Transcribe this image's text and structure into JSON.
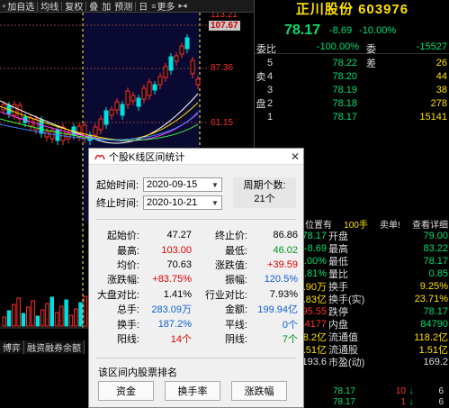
{
  "toolbar": {
    "items": [
      {
        "label": "加自选"
      },
      {
        "label": "均线"
      },
      {
        "label": "复权"
      },
      {
        "label": "叠"
      },
      {
        "label": "加"
      },
      {
        "label": "预测"
      },
      {
        "label": "日"
      },
      {
        "label": "更多"
      }
    ]
  },
  "chart": {
    "price_top": "113.21",
    "price_box": "107.67",
    "price_mid": "87.36",
    "price_low": "61.15",
    "bottom_tabs": [
      "博弈",
      "融资融券余额"
    ]
  },
  "quote": {
    "name": "正川股份",
    "code": "603976",
    "price": "78.17",
    "change": "-8.69",
    "change_pct": "-10.00%",
    "ratio_label": "委比",
    "ratio_value": "-100.00%",
    "diff_label": "委差",
    "diff_value": "-15527",
    "sell_label": "卖盘",
    "buy_label": "买盘",
    "asks": [
      {
        "level": "5",
        "price": "78.22",
        "vol": "26"
      },
      {
        "level": "4",
        "price": "78.20",
        "vol": "44"
      },
      {
        "level": "3",
        "price": "78.19",
        "vol": "38"
      },
      {
        "level": "2",
        "price": "78.18",
        "vol": "278"
      },
      {
        "level": "1",
        "price": "78.17",
        "vol": "15141"
      }
    ],
    "bids": [
      {
        "level": "1",
        "price": "",
        "vol": ""
      },
      {
        "level": "2",
        "price": "",
        "vol": ""
      },
      {
        "level": "3",
        "price": "",
        "vol": ""
      },
      {
        "level": "4",
        "price": "",
        "vol": ""
      },
      {
        "level": "5",
        "price": "",
        "vol": ""
      }
    ],
    "vol_header": {
      "a": "位置有",
      "b": "100手",
      "c": "卖单!",
      "d": "查看详细"
    },
    "rows": [
      {
        "a": "78.17",
        "b": "开盘",
        "c": "79.00",
        "ac": "green",
        "cc": "green"
      },
      {
        "a": "-8.69",
        "b": "最高",
        "c": "83.22",
        "ac": "green",
        "cc": "green"
      },
      {
        "a": "-10.00%",
        "b": "最低",
        "c": "78.17",
        "ac": "green",
        "cc": "green"
      },
      {
        "a": "5.81%",
        "b": "量比",
        "c": "0.85",
        "ac": "green",
        "cc": "green"
      },
      {
        "a": "14.90万",
        "b": "换手",
        "c": "9.25%",
        "ac": "yellow",
        "cc": "yellow"
      },
      {
        "a": "11.83亿",
        "b": "换手(实)",
        "c": "23.71%",
        "ac": "yellow",
        "cc": "yellow"
      },
      {
        "a": "95.55",
        "b": "跌停",
        "c": "78.17",
        "ac": "red",
        "cc": "green"
      },
      {
        "a": "64177",
        "b": "内盘",
        "c": "84790",
        "ac": "red",
        "cc": "green"
      },
      {
        "a": "118.2亿",
        "b": "流通值",
        "c": "118.2亿",
        "ac": "yellow",
        "cc": "yellow"
      },
      {
        "a": "1.51亿",
        "b": "流通股",
        "c": "1.51亿",
        "ac": "yellow",
        "cc": "yellow"
      },
      {
        "a": "193.6",
        "b": "市盈(动)",
        "c": "169.2",
        "ac": "white",
        "cc": "white"
      }
    ],
    "ticks": [
      {
        "p": "78.17",
        "v": "10",
        "flag": "6"
      },
      {
        "p": "78.17",
        "v": "1",
        "flag": "6"
      }
    ]
  },
  "dialog": {
    "title": "个股K线区间统计",
    "start_label": "起始时间:",
    "start_value": "2020-09-15",
    "end_label": "终止时间:",
    "end_value": "2020-10-21",
    "days_label": "周期个数:",
    "days_value": "21个",
    "stats": [
      {
        "l1": "起始价:",
        "v1": "47.27",
        "c1": "d-black",
        "l2": "终止价:",
        "v2": "86.86",
        "c2": "d-black"
      },
      {
        "l1": "最高:",
        "v1": "103.00",
        "c1": "d-red",
        "l2": "最低:",
        "v2": "46.02",
        "c2": "d-green"
      },
      {
        "l1": "均价:",
        "v1": "70.63",
        "c1": "d-black",
        "l2": "涨跌值:",
        "v2": "+39.59",
        "c2": "d-red"
      },
      {
        "l1": "涨跌幅:",
        "v1": "+83.75%",
        "c1": "d-red",
        "l2": "振幅:",
        "v2": "120.5%",
        "c2": "d-blue"
      },
      {
        "l1": "大盘对比:",
        "v1": "1.41%",
        "c1": "d-black",
        "l2": "行业对比:",
        "v2": "7.93%",
        "c2": "d-black"
      },
      {
        "l1": "总手:",
        "v1": "283.09万",
        "c1": "d-blue",
        "l2": "金额:",
        "v2": "199.94亿",
        "c2": "d-blue"
      },
      {
        "l1": "换手:",
        "v1": "187.2%",
        "c1": "d-blue",
        "l2": "平线:",
        "v2": "0个",
        "c2": "d-blue"
      },
      {
        "l1": "阳线:",
        "v1": "14个",
        "c1": "d-red",
        "l2": "阴线:",
        "v2": "7个",
        "c2": "d-green"
      }
    ],
    "rank_title": "该区间内股票排名",
    "buttons": [
      "资金",
      "换手率",
      "涨跌幅"
    ]
  },
  "colors": {
    "up": "#ff3030",
    "down": "#00e070",
    "highlight": "#ffe000",
    "dialog_bg": "#f0f0f0"
  }
}
